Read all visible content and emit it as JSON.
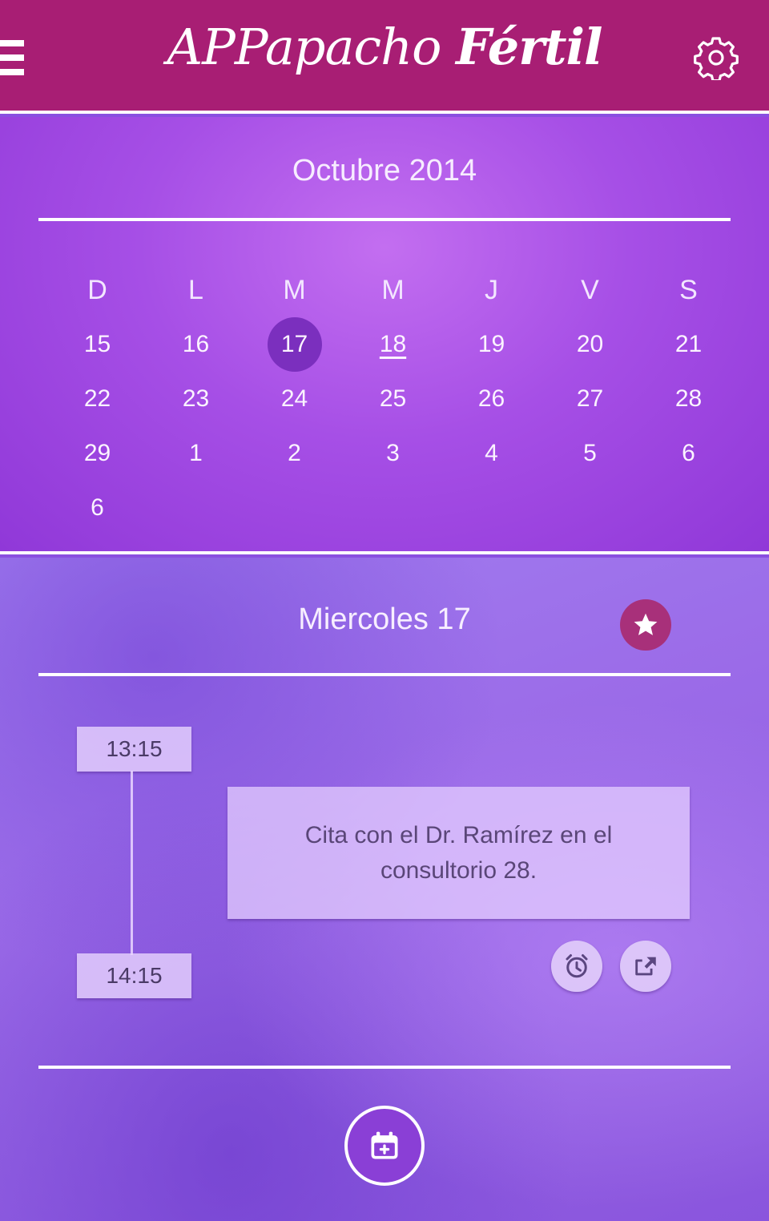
{
  "header": {
    "title_part1": "APPapacho ",
    "title_part2": "Fértil",
    "menu_icon": "hamburger-menu-icon",
    "settings_icon": "gear-icon"
  },
  "calendar": {
    "month_label": "Octubre 2014",
    "weekdays": [
      "D",
      "L",
      "M",
      "M",
      "J",
      "V",
      "S"
    ],
    "weeks": [
      [
        "15",
        "16",
        "17",
        "18",
        "19",
        "20",
        "21"
      ],
      [
        "22",
        "23",
        "24",
        "25",
        "26",
        "27",
        "28"
      ],
      [
        "29",
        "1",
        "2",
        "3",
        "4",
        "5",
        "6"
      ],
      [
        "6",
        "",
        "",
        "",
        "",
        "",
        ""
      ]
    ],
    "selected_day": "17",
    "underlined_day": "18"
  },
  "day": {
    "title": "Miercoles 17",
    "favorite_icon": "star-icon",
    "start_time": "13:15",
    "end_time": "14:15",
    "event_text": "Cita con el Dr. Ramírez en el consultorio 28.",
    "alarm_icon": "alarm-clock-icon",
    "share_icon": "share-icon",
    "add_event_icon": "calendar-add-icon"
  },
  "colors": {
    "header_bg": "#a81e74",
    "calendar_bg": "#a64fe6",
    "selected_day_bg": "#7b2fbe",
    "favorite_bg": "#a8307a"
  }
}
